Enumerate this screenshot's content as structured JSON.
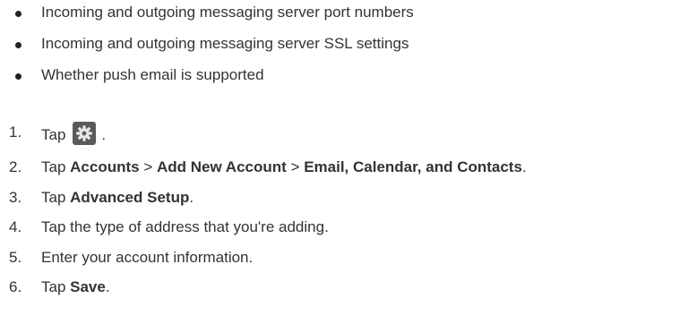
{
  "bullets": [
    "Incoming and outgoing messaging server port numbers",
    "Incoming and outgoing messaging server SSL settings",
    "Whether push email is supported"
  ],
  "steps": {
    "s1": {
      "num": "1.",
      "before": "Tap",
      "icon": "gear-icon",
      "after": "."
    },
    "s2": {
      "num": "2.",
      "t1": "Tap ",
      "b1": "Accounts",
      "t2": " > ",
      "b2": "Add New Account",
      "t3": " > ",
      "b3": "Email, Calendar, and Contacts",
      "t4": "."
    },
    "s3": {
      "num": "3.",
      "t1": "Tap ",
      "b1": "Advanced Setup",
      "t2": "."
    },
    "s4": {
      "num": "4.",
      "text": "Tap the type of address that you're adding."
    },
    "s5": {
      "num": "5.",
      "text": "Enter your account information."
    },
    "s6": {
      "num": "6.",
      "t1": "Tap ",
      "b1": "Save",
      "t2": "."
    }
  },
  "colors": {
    "text": "#333333",
    "icon_bg": "#5a5a5a",
    "icon_fg": "#e8e8e8"
  }
}
